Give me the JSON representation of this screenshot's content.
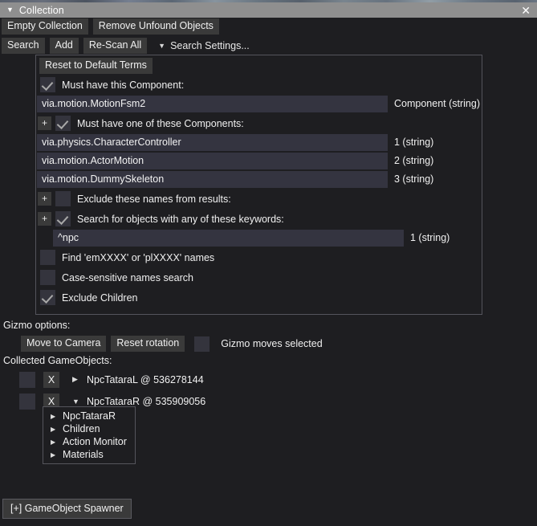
{
  "window": {
    "title": "Collection",
    "collapse_icon": "triangle-down-icon",
    "close_icon": "✕"
  },
  "toolbar_primary": {
    "empty_collection": "Empty Collection",
    "remove_unfound": "Remove Unfound Objects"
  },
  "toolbar_secondary": {
    "search": "Search",
    "add": "Add",
    "rescan_all": "Re-Scan All",
    "search_settings_label": "Search Settings...",
    "search_settings_icon": "triangle-down-icon"
  },
  "search_settings": {
    "reset_button": "Reset to Default Terms",
    "must_have_component": {
      "label": "Must have this Component:",
      "checked": true,
      "value": "via.motion.MotionFsm2",
      "tag": "Component (string)"
    },
    "must_have_one_of": {
      "label": "Must have one of these Components:",
      "checked": true,
      "add_icon": "+",
      "entries": [
        {
          "value": "via.physics.CharacterController",
          "tag": "1 (string)"
        },
        {
          "value": "via.motion.ActorMotion",
          "tag": "2 (string)"
        },
        {
          "value": "via.motion.DummySkeleton",
          "tag": "3 (string)"
        }
      ]
    },
    "exclude_names": {
      "label": "Exclude these names from results:",
      "checked": false,
      "add_icon": "+"
    },
    "keywords": {
      "label": "Search for objects with any of these keywords:",
      "checked": true,
      "add_icon": "+",
      "entries": [
        {
          "value": "^npc",
          "tag": "1 (string)"
        }
      ]
    },
    "find_em_pl": {
      "label": "Find 'emXXXX' or 'plXXXX' names",
      "checked": false
    },
    "case_sensitive": {
      "label": "Case-sensitive names search",
      "checked": false
    },
    "exclude_children": {
      "label": "Exclude Children",
      "checked": true
    }
  },
  "gizmo": {
    "section_label": "Gizmo options:",
    "move_to_camera": "Move to Camera",
    "reset_rotation": "Reset rotation",
    "moves_selected_label": "Gizmo moves selected",
    "moves_selected_checked": false
  },
  "collected": {
    "section_label": "Collected GameObjects:",
    "remove_icon": "X",
    "items": [
      {
        "checked": false,
        "expanded": false,
        "expand_icon": "▶",
        "name": "NpcTataraL @ 536278144"
      },
      {
        "checked": false,
        "expanded": true,
        "expand_icon": "▼",
        "name": "NpcTataraR @ 535909056"
      }
    ],
    "tree": {
      "expand_icon": "▶",
      "items": [
        {
          "label": "NpcTataraR"
        },
        {
          "label": "Children"
        },
        {
          "label": "Action Monitor"
        },
        {
          "label": "Materials"
        }
      ]
    }
  },
  "spawner": {
    "label": "[+] GameObject Spawner"
  },
  "colors": {
    "background": "#1e1e21",
    "titlebar": "#8f8f8f",
    "button": "#3a3a3a",
    "field": "#343440",
    "checkbox": "#34343d",
    "border": "#54545c",
    "text": "#f0f0f0"
  }
}
